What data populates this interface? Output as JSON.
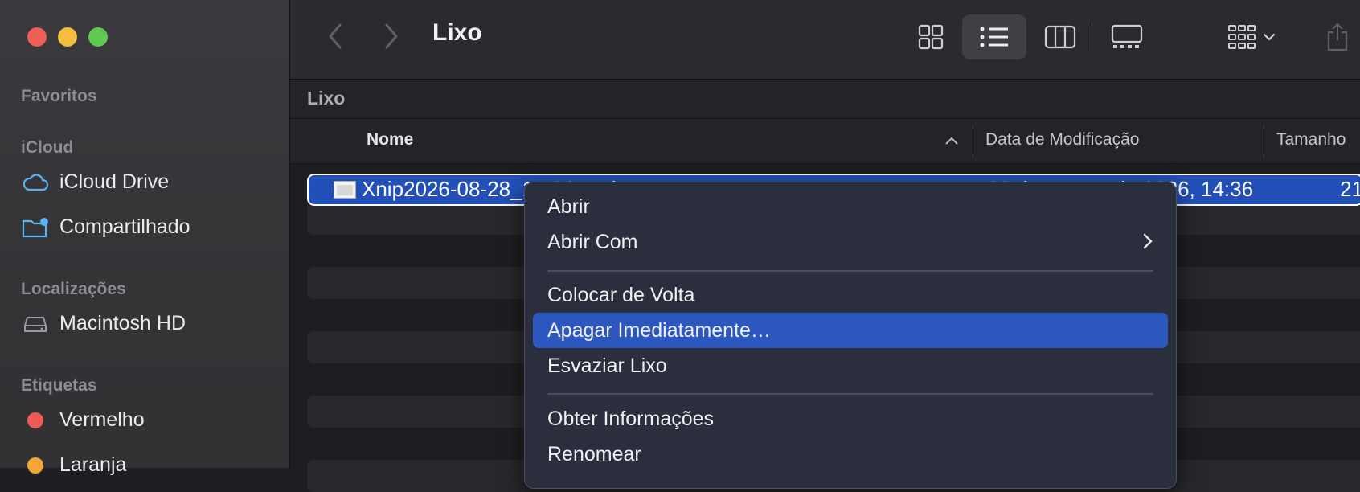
{
  "window": {
    "title": "Lixo"
  },
  "sidebar": {
    "sections": {
      "favorites": "Favoritos",
      "icloud": "iCloud",
      "locations": "Localizações",
      "tags": "Etiquetas"
    },
    "icloud_items": [
      {
        "label": "iCloud Drive",
        "icon": "cloud-icon"
      },
      {
        "label": "Compartilhado",
        "icon": "shared-folder-icon"
      }
    ],
    "location_items": [
      {
        "label": "Macintosh HD",
        "icon": "disk-icon"
      }
    ],
    "tag_items": [
      {
        "label": "Vermelho",
        "color": "#ee5b55"
      },
      {
        "label": "Laranja",
        "color": "#f3a536"
      }
    ]
  },
  "pathbar": {
    "label": "Lixo"
  },
  "columns": {
    "name": "Nome",
    "date": "Data de Modificação",
    "size": "Tamanho"
  },
  "selected_file": {
    "name": "Xnip2026-08-28_14-36-45.jpg",
    "date": "28 de agosto de 2026, 14:36",
    "size": "21"
  },
  "context_menu": {
    "items": [
      "Abrir",
      "Abrir Com",
      "Colocar de Volta",
      "Apagar Imediatamente…",
      "Esvaziar Lixo",
      "Obter Informações",
      "Renomear"
    ],
    "highlighted": "Apagar Imediatamente…"
  },
  "colors": {
    "selection": "#2350b8",
    "menu_highlight": "#2c57bf",
    "accent_icon": "#5ab4f0"
  }
}
